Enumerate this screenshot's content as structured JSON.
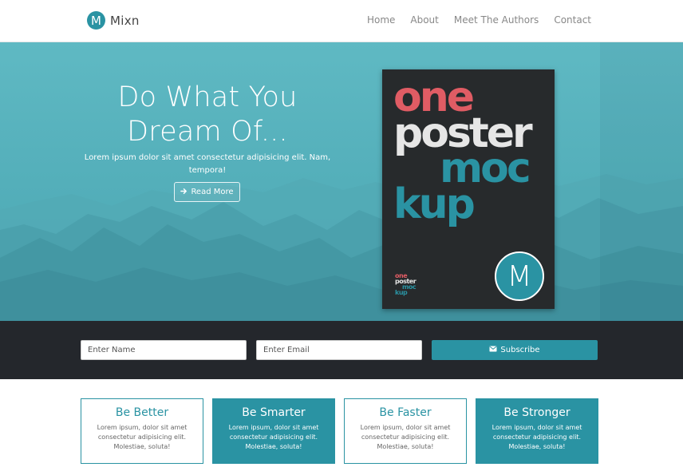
{
  "nav": {
    "logo_letter": "M",
    "brand": "Mixn",
    "links": [
      "Home",
      "About",
      "Meet The Authors",
      "Contact"
    ]
  },
  "hero": {
    "title_line1": "Do What You",
    "title_line2": "Dream Of...",
    "subtitle": "Lorem ipsum dolor sit amet consectetur adipisicing elit. Nam, tempora!",
    "button_icon": "arrow-right-icon",
    "button_label": "Read More",
    "poster": {
      "line1": "one",
      "line2": "poster",
      "line3": "moc",
      "line4": "kup",
      "mini1": "one",
      "mini2": "poster",
      "mini3": "moc",
      "mini4": "kup",
      "badge_letter": "M"
    }
  },
  "subscribe": {
    "name_placeholder": "Enter Name",
    "email_placeholder": "Enter Email",
    "button_icon": "envelope-icon",
    "button_label": "Subscribe"
  },
  "features": [
    {
      "title": "Be Better",
      "text": "Lorem ipsum, dolor sit amet consectetur adipisicing elit. Molestiae, soluta!"
    },
    {
      "title": "Be Smarter",
      "text": "Lorem ipsum, dolor sit amet consectetur adipisicing elit. Molestiae, soluta!"
    },
    {
      "title": "Be Faster",
      "text": "Lorem ipsum, dolor sit amet consectetur adipisicing elit. Molestiae, soluta!"
    },
    {
      "title": "Be Stronger",
      "text": "Lorem ipsum, dolor sit amet consectetur adipisicing elit. Molestiae, soluta!"
    }
  ],
  "colors": {
    "accent": "#2a93a3",
    "poster_red": "#e05c64",
    "dark_bar": "#24272c",
    "hero_teal": "#55b0bb"
  }
}
